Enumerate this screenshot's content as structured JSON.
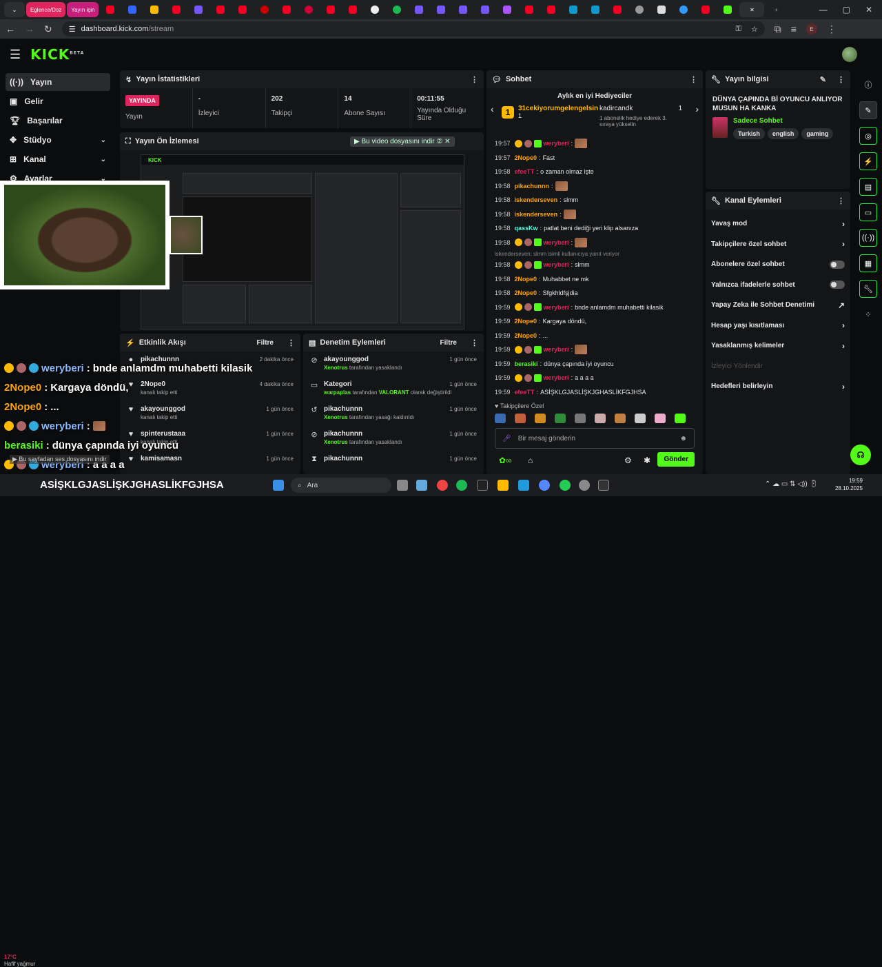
{
  "browser": {
    "tabs": [
      {
        "label": "Eglence/Doz"
      },
      {
        "label": "Yayın için"
      }
    ],
    "url_host": "dashboard.kick.com",
    "url_path": "/stream"
  },
  "brand": {
    "logo": "KICK",
    "beta": "BETA",
    "accent": "#53fc18"
  },
  "sidebar": {
    "items": [
      {
        "label": "Yayın",
        "icon": "broadcast-icon"
      },
      {
        "label": "Gelir",
        "icon": "revenue-icon"
      },
      {
        "label": "Başarılar",
        "icon": "trophy-icon"
      },
      {
        "label": "Stüdyo",
        "icon": "studio-icon"
      },
      {
        "label": "Kanal",
        "icon": "channel-icon"
      },
      {
        "label": "Ayarlar",
        "icon": "gear-icon"
      }
    ]
  },
  "stats": {
    "title": "Yayın İstatistikleri",
    "live_badge": "YAYINDA",
    "live_label": "Yayın",
    "viewers_value": "-",
    "viewers_label": "İzleyici",
    "followers_value": "202",
    "followers_label": "Takipçi",
    "subs_value": "14",
    "subs_label": "Abone Sayısı",
    "uptime_value": "00:11:55",
    "uptime_label": "Yayında Olduğu Süre"
  },
  "preview": {
    "title": "Yayın Ön İzlemesi",
    "download_label": "Bu video dosyasını indir"
  },
  "events": {
    "title": "Etkinlik Akışı",
    "filter": "Filtre",
    "rows": [
      {
        "user": "pikachunnn",
        "sub": "",
        "time": "2 dakika önce",
        "icon": "gift-icon"
      },
      {
        "user": "2Nope0",
        "sub": "kanalı takip etti",
        "time": "4 dakika önce",
        "icon": "heart-icon"
      },
      {
        "user": "akayounggod",
        "sub": "kanalı takip etti",
        "time": "1 gün önce",
        "icon": "heart-icon"
      },
      {
        "user": "spinterustaaa",
        "sub": "kanalı takip etti",
        "time": "1 gün önce",
        "icon": "heart-icon"
      },
      {
        "user": "kamisamasn",
        "sub": "",
        "time": "1 gün önce",
        "icon": "heart-icon"
      }
    ]
  },
  "mod": {
    "title": "Denetim Eylemleri",
    "filter": "Filtre",
    "rows": [
      {
        "title": "akayounggod",
        "actor": "Xenotrus",
        "rest": "tarafından yasaklandı",
        "time": "1 gün önce",
        "icon": "ban-icon"
      },
      {
        "title": "Kategori",
        "actor": "warpaplas",
        "rest": "tarafından",
        "extra": "VALORANT",
        "extra_rest": "olarak değiştirildi",
        "time": "1 gün önce",
        "icon": "category-icon"
      },
      {
        "title": "pikachunnn",
        "actor": "Xenotrus",
        "rest": "tarafından yasağı kaldırıldı",
        "time": "1 gün önce",
        "icon": "unban-icon"
      },
      {
        "title": "pikachunnn",
        "actor": "Xenotrus",
        "rest": "tarafından yasaklandı",
        "time": "1 gün önce",
        "icon": "ban-icon"
      },
      {
        "title": "pikachunnn",
        "actor": "",
        "rest": "",
        "time": "1 gün önce",
        "icon": "timeout-icon"
      }
    ]
  },
  "chat": {
    "title": "Sohbet",
    "gifters_title": "Aylık en iyi Hediyeciler",
    "gifter1": "31cekiyorumgelengelsin",
    "gifter1_count": "1",
    "gifter2": "kadircandk",
    "gifter2_count": "1",
    "gifter2_note": "1 abonelik hediye ederek 3. sıraya yükselin",
    "messages": [
      {
        "ts": "19:57",
        "user": "weryberi",
        "color": "#e0245e",
        "text": "",
        "emote": true
      },
      {
        "ts": "19:57",
        "user": "2Nope0",
        "color": "#ffa500",
        "text": "Fast"
      },
      {
        "ts": "19:58",
        "user": "efeeTT",
        "color": "#e0245e",
        "text": "o zaman olmaz işte"
      },
      {
        "ts": "19:58",
        "user": "pikachunnn",
        "color": "#ffa500",
        "text": "",
        "emote": true
      },
      {
        "ts": "19:58",
        "user": "iskenderseven",
        "color": "#ffa500",
        "text": "slmm"
      },
      {
        "ts": "19:58",
        "user": "iskenderseven",
        "color": "#ffa500",
        "text": "",
        "emote": true
      },
      {
        "ts": "19:58",
        "user": "qassKw",
        "color": "#5fd",
        "text": "patlat beni dediği yeri klip alsanıza"
      },
      {
        "ts": "19:58",
        "user": "weryberi",
        "color": "#e0245e",
        "text": "",
        "emote": true
      },
      {
        "ts": "19:58",
        "user": "weryberi",
        "color": "#e0245e",
        "text": "slmm",
        "reply": "iskenderseven: slmm isimli kullanıcıya yanıt veriyor"
      },
      {
        "ts": "19:58",
        "user": "2Nope0",
        "color": "#ffa500",
        "text": "Muhabbet ne mk"
      },
      {
        "ts": "19:58",
        "user": "2Nope0",
        "color": "#ffa500",
        "text": "Sfgkhldfşjdia"
      },
      {
        "ts": "19:59",
        "user": "weryberi",
        "color": "#e0245e",
        "text": "bnde anlamdm muhabetti kilasik"
      },
      {
        "ts": "19:59",
        "user": "2Nope0",
        "color": "#ffa500",
        "text": "Kargaya döndü,"
      },
      {
        "ts": "19:59",
        "user": "2Nope0",
        "color": "#ffa500",
        "text": "..."
      },
      {
        "ts": "19:59",
        "user": "weryberi",
        "color": "#e0245e",
        "text": "",
        "emote": true
      },
      {
        "ts": "19:59",
        "user": "berasiki",
        "color": "#53fc18",
        "text": "dünya çapında iyi oyuncu"
      },
      {
        "ts": "19:59",
        "user": "weryberi",
        "color": "#e0245e",
        "text": "a a a a"
      },
      {
        "ts": "19:59",
        "user": "efeeTT",
        "color": "#e0245e",
        "text": "ASİŞKLGJASLİŞKJGHASLİKFGJHSA"
      }
    ],
    "follower_only": "Takipçilere Özel",
    "input_placeholder": "Bir mesaj gönderin",
    "send": "Gönder"
  },
  "info": {
    "title": "Yayın bilgisi",
    "stream_title": "DÜNYA ÇAPINDA Bİ OYUNCU ANLIYOR MUSUN HA KANKA",
    "category": "Sadece Sohbet",
    "tags": [
      "Turkish",
      "english",
      "gaming"
    ]
  },
  "actions": {
    "title": "Kanal Eylemleri",
    "rows": [
      {
        "label": "Yavaş mod",
        "kind": "arrow"
      },
      {
        "label": "Takipçilere özel sohbet",
        "kind": "arrow"
      },
      {
        "label": "Abonelere özel sohbet",
        "kind": "toggle"
      },
      {
        "label": "Yalnızca ifadelerle sohbet",
        "kind": "toggle"
      },
      {
        "label": "Yapay Zeka ile Sohbet Denetimi",
        "kind": "ext"
      },
      {
        "label": "Hesap yaşı kısıtlaması",
        "kind": "arrow"
      },
      {
        "label": "Yasaklanmış kelimeler",
        "kind": "arrow"
      },
      {
        "label": "İzleyici Yönlendir",
        "kind": "disabled"
      },
      {
        "label": "Hedefleri belirleyin",
        "kind": "arrow"
      }
    ]
  },
  "overlay": {
    "lines": [
      {
        "user": "weryberi",
        "color": "#8bf",
        "text": "bnde anlamdm muhabetti kilasik"
      },
      {
        "user": "2Nope0",
        "color": "#ffa500",
        "text": "Kargaya döndü,"
      },
      {
        "user": "2Nope0",
        "color": "#ffa500",
        "text": "..."
      },
      {
        "user": "weryberi",
        "color": "#8bf",
        "text": ""
      },
      {
        "user": "berasiki",
        "color": "#53fc18",
        "text": "dünya çapında iyi oyuncu"
      },
      {
        "user": "weryberi",
        "color": "#8bf",
        "text": "a a a a"
      }
    ],
    "download_hint": "Bu sayfadan ses dosyasını indir",
    "big_line": "ASİŞKLGJASLİŞKJGHASLİKFGJHSA",
    "weather_temp": "17°C",
    "weather_text": "Hafif yağmur"
  },
  "taskbar": {
    "search": "Ara",
    "time": "19:59",
    "date": "28.10.2025"
  }
}
